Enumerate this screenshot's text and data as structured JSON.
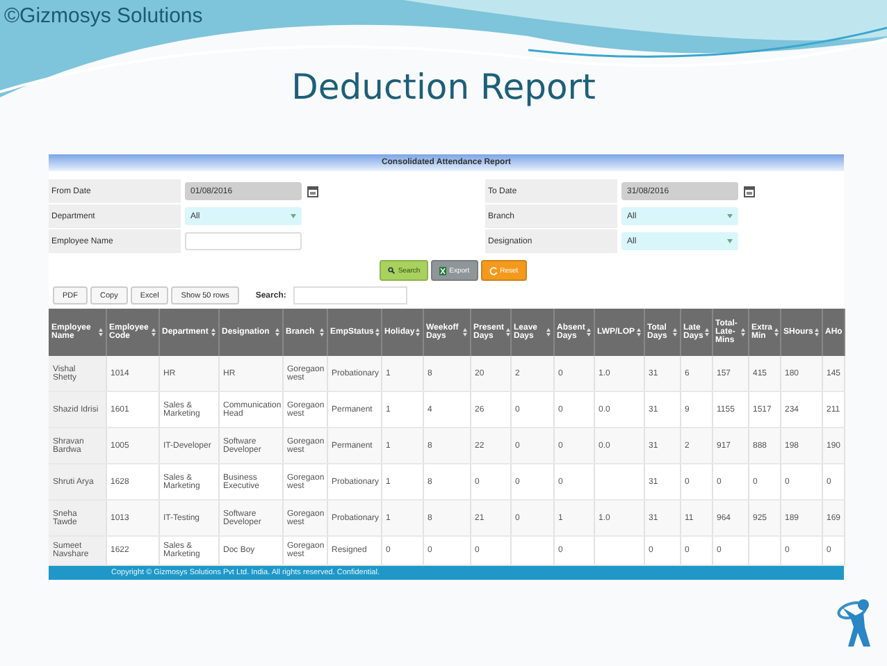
{
  "slide": {
    "brand": "©Gizmosys Solutions",
    "title": "Deduction Report"
  },
  "report": {
    "title": "Consolidated Attendance Report",
    "filters_left": [
      {
        "label": "From Date",
        "kind": "date",
        "value": "01/08/2016"
      },
      {
        "label": "Department",
        "kind": "select",
        "value": "All"
      },
      {
        "label": "Employee Name",
        "kind": "text"
      }
    ],
    "filters_right": [
      {
        "label": "To Date",
        "kind": "date",
        "value": "31/08/2016"
      },
      {
        "label": "Branch",
        "kind": "select",
        "value": "All"
      },
      {
        "label": "Designation",
        "kind": "select",
        "value": "All"
      }
    ],
    "actions": [
      {
        "label": "Search",
        "kind": "search"
      },
      {
        "label": "Export",
        "kind": "export"
      },
      {
        "label": "Reset",
        "kind": "reset"
      }
    ],
    "table_tools": {
      "buttons": [
        "PDF",
        "Copy",
        "Excel",
        "Show 50 rows"
      ],
      "search_label": "Search:"
    },
    "table": {
      "columns": [
        "Employee Name",
        "Employee Code",
        "Department",
        "Designation",
        "Branch",
        "EmpStatus",
        "Holiday",
        "Weekoff Days",
        "Present Days",
        "Leave Days",
        "Absent Days",
        "LWP/LOP",
        "Total Days",
        "Late Days",
        "Total-Late-Mins",
        "Extra Min",
        "SHours",
        "AHo"
      ],
      "rows": [
        [
          "Vishal Shetty",
          "1014",
          "HR",
          "HR",
          "Goregaon west",
          "Probationary",
          "1",
          "8",
          "20",
          "2",
          "0",
          "1.0",
          "31",
          "6",
          "157",
          "415",
          "180",
          "145"
        ],
        [
          "Shazid Idrisi",
          "1601",
          "Sales & Marketing",
          "Communication Head",
          "Goregaon west",
          "Permanent",
          "1",
          "4",
          "26",
          "0",
          "0",
          "0.0",
          "31",
          "9",
          "1155",
          "1517",
          "234",
          "211"
        ],
        [
          "Shravan Bardwa",
          "1005",
          "IT-Developer",
          "Software Developer",
          "Goregaon west",
          "Permanent",
          "1",
          "8",
          "22",
          "0",
          "0",
          "0.0",
          "31",
          "2",
          "917",
          "888",
          "198",
          "190"
        ],
        [
          "Shruti Arya",
          "1628",
          "Sales & Marketing",
          "Business Executive",
          "Goregaon west",
          "Probationary",
          "1",
          "8",
          "0",
          "0",
          "0",
          null,
          "31",
          "0",
          "0",
          "0",
          "0",
          "0"
        ],
        [
          "Sneha Tawde",
          "1013",
          "IT-Testing",
          "Software Developer",
          "Goregaon west",
          "Probationary",
          "1",
          "8",
          "21",
          "0",
          "1",
          "1.0",
          "31",
          "11",
          "964",
          "925",
          "189",
          "169"
        ],
        [
          "Sumeet Navshare",
          "1622",
          "Sales & Marketing",
          "Doc Boy",
          "Goregaon west",
          "Resigned",
          "0",
          "0",
          "0",
          null,
          "0",
          null,
          "0",
          "0",
          "0",
          null,
          "0",
          "0"
        ]
      ]
    },
    "footer": "Copyright © Gizmosys Solutions Pvt Ltd. India. All rights reserved. Confidential."
  }
}
